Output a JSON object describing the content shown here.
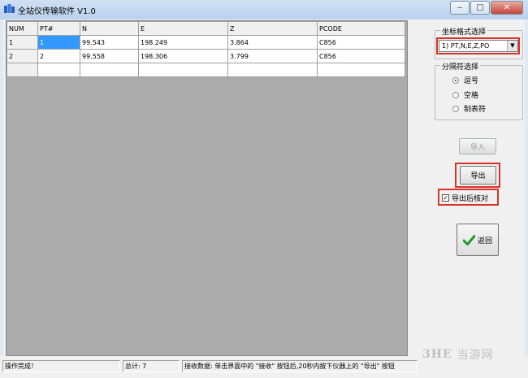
{
  "window": {
    "title": "全站仪传输软件  V1.0"
  },
  "grid": {
    "columns": [
      "NUM",
      "PT#",
      "N",
      "E",
      "Z",
      "PCODE"
    ],
    "rows": [
      [
        "1",
        "1",
        "99.543",
        "198.249",
        "3.864",
        "C856"
      ],
      [
        "2",
        "2",
        "99.558",
        "198.306",
        "3.799",
        "C856"
      ],
      [
        "",
        "",
        "",
        "",
        "",
        ""
      ]
    ]
  },
  "coord_format": {
    "group_label": "坐标格式选择",
    "selected": "1) PT,N,E,Z,PO"
  },
  "separator": {
    "group_label": "分隔符选择",
    "options": [
      "逗号",
      "空格",
      "制表符"
    ],
    "selected_index": 0
  },
  "buttons": {
    "import_label": "导入",
    "export_label": "导出",
    "back_label": "返回"
  },
  "checkbox": {
    "label": "导出后核对",
    "checked": true
  },
  "status": {
    "left": "操作完成！",
    "total": "总计: 7",
    "hint": "接收数据: 单击界面中的 \"接收\" 按钮后,20秒内按下仪器上的 \"导出\" 按钮"
  },
  "watermark": {
    "logo": "3HE",
    "text": "当游网"
  },
  "colors": {
    "highlight_box": "#d8332a",
    "selected_cell": "#3399ff"
  }
}
